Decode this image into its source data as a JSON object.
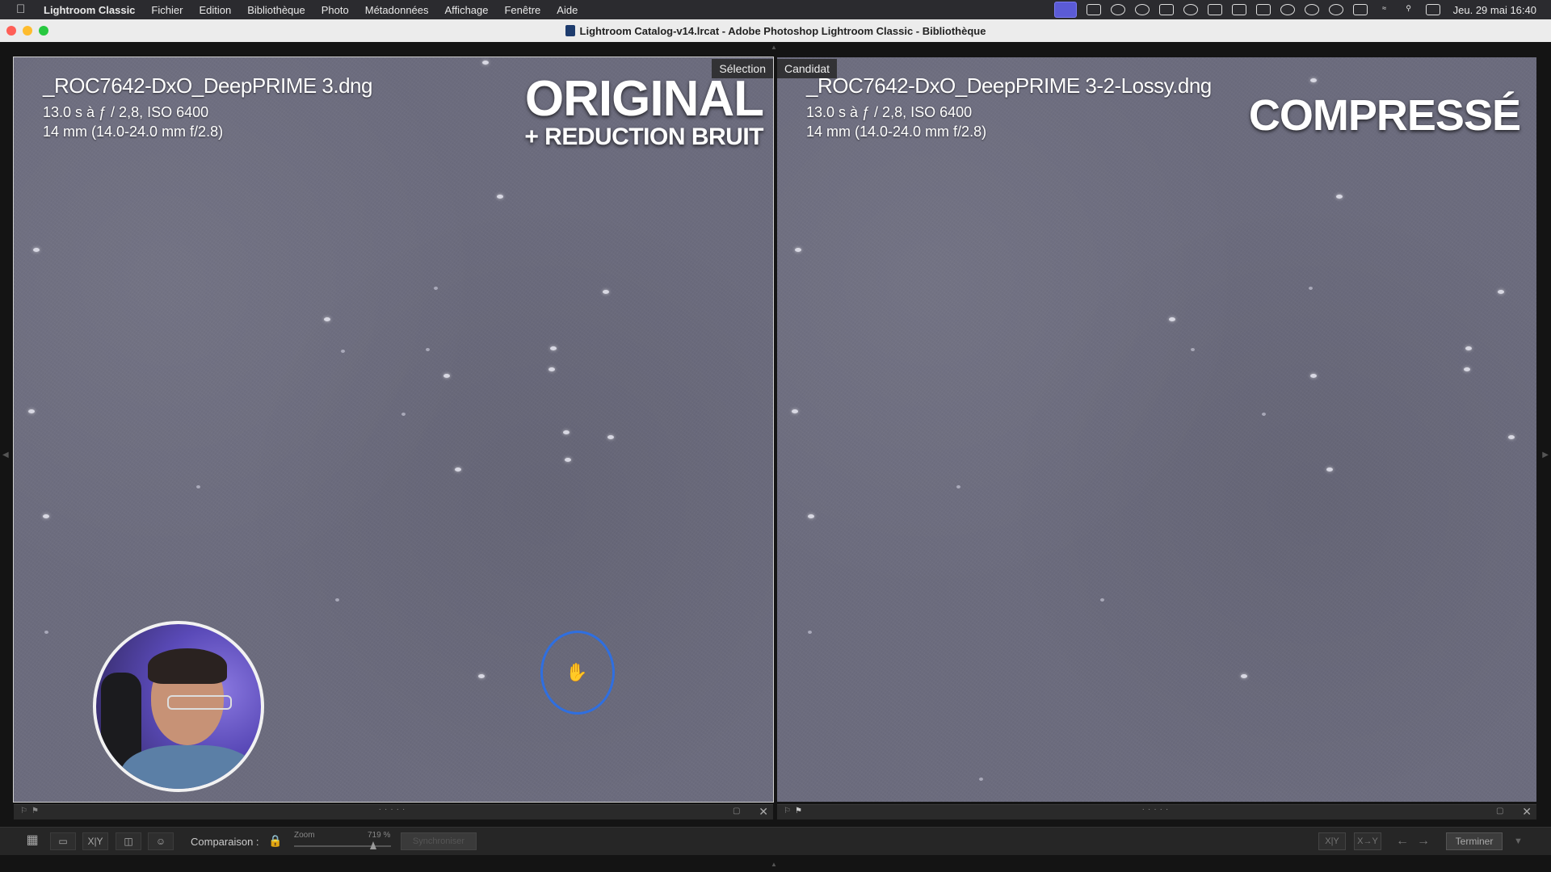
{
  "menubar": {
    "app_name": "Lightroom Classic",
    "items": [
      "Fichier",
      "Edition",
      "Bibliothèque",
      "Photo",
      "Métadonnées",
      "Affichage",
      "Fenêtre",
      "Aide"
    ],
    "status_icons": [
      "screen-record-icon",
      "camera-icon",
      "play-circle-icon",
      "w-icon",
      "pr-icon",
      "creative-cloud-icon",
      "clipboard-icon",
      "grid-icon",
      "window-icon",
      "user-icon",
      "play-icon",
      "clock-icon",
      "battery-icon",
      "wifi-icon",
      "search-icon",
      "control-center-icon"
    ],
    "clock": "Jeu. 29 mai  16:40"
  },
  "window": {
    "title": "Lightroom Catalog-v14.lrcat - Adobe Photoshop Lightroom Classic - Bibliothèque"
  },
  "left_pane": {
    "tag": "Sélection",
    "filename": "_ROC7642-DxO_DeepPRIME 3.dng",
    "exposure": "13.0 s à ƒ / 2,8, ISO 6400",
    "lens": "14 mm (14.0-24.0 mm f/2.8)",
    "overlay_title": "ORIGINAL",
    "overlay_subtitle": "+ REDUCTION BRUIT"
  },
  "right_pane": {
    "tag": "Candidat",
    "filename": "_ROC7642-DxO_DeepPRIME 3-2-Lossy.dng",
    "exposure": "13.0 s à ƒ / 2,8, ISO 6400",
    "lens": "14 mm (14.0-24.0 mm f/2.8)",
    "overlay_title": "COMPRESSÉ"
  },
  "toolbar": {
    "comparison_label": "Comparaison :",
    "zoom_label": "Zoom",
    "zoom_value": "719 %",
    "sync_label": "Synchroniser",
    "done_label": "Terminer"
  },
  "colors": {
    "sky": "#6c6c7e",
    "cursor_ring": "#2f6fe0",
    "cursor_hand": "#e22222"
  }
}
